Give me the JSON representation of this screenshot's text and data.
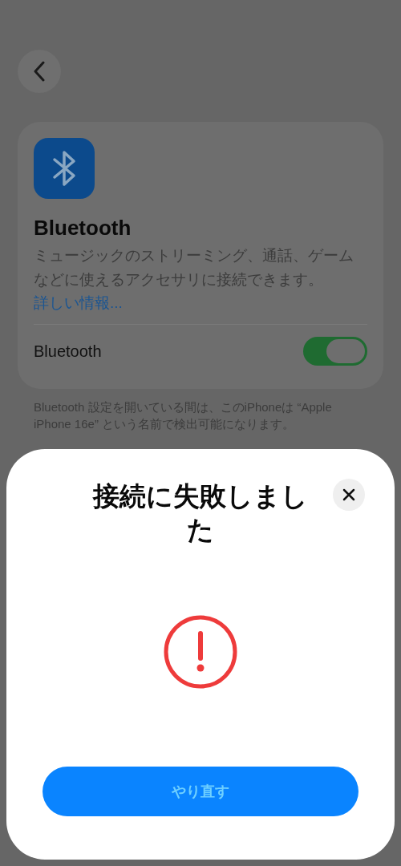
{
  "settings": {
    "title": "Bluetooth",
    "description": "ミュージックのストリーミング、通話、ゲームなどに使えるアクセサリに接続できます。",
    "link": "詳しい情報...",
    "toggle": {
      "label": "Bluetooth",
      "on": true
    },
    "footnote": "Bluetooth 設定を開いている間は、このiPhoneは “Apple iPhone 16e” という名前で検出可能になります。"
  },
  "sheet": {
    "title": "接続に失敗しました",
    "button": "やり直す"
  }
}
